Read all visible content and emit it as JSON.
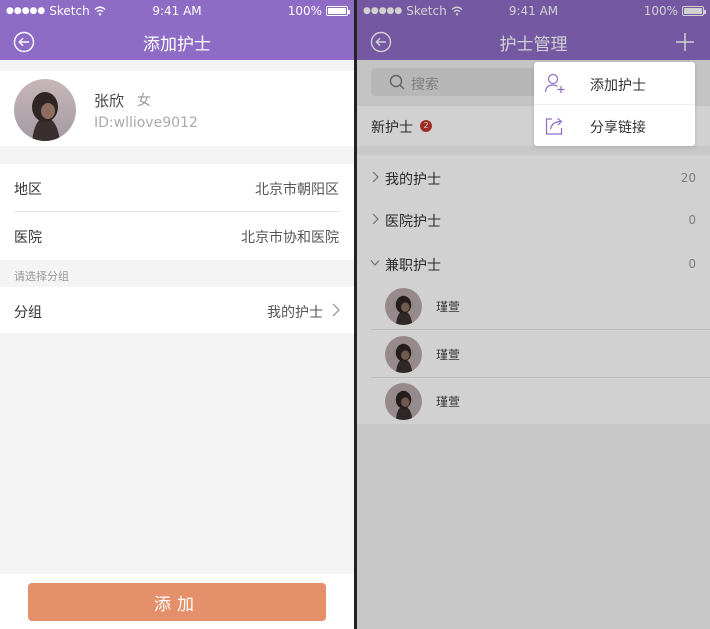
{
  "status_bar": {
    "dots": "●●●●●",
    "carrier": "Sketch",
    "time": "9:41 AM",
    "battery": "100%"
  },
  "left": {
    "title": "添加护士",
    "profile": {
      "name": "张欣",
      "gender": "女",
      "id": "ID:wlliove9012"
    },
    "fields": [
      {
        "label": "地区",
        "value": "北京市朝阳区"
      },
      {
        "label": "医院",
        "value": "北京市协和医院"
      }
    ],
    "group_hint": "请选择分组",
    "group": {
      "label": "分组",
      "value": "我的护士"
    },
    "add_button": "添加"
  },
  "right": {
    "title": "护士管理",
    "search_placeholder": "搜索",
    "new_nurse": {
      "label": "新护士",
      "badge": "2"
    },
    "groups": [
      {
        "label": "我的护士",
        "count": "20",
        "expanded": false
      },
      {
        "label": "医院护士",
        "count": "0",
        "expanded": false
      },
      {
        "label": "兼职护士",
        "count": "0",
        "expanded": true
      }
    ],
    "members": [
      {
        "name": "瑾萱"
      },
      {
        "name": "瑾萱"
      },
      {
        "name": "瑾萱"
      }
    ],
    "popup_menu": [
      {
        "label": "添加护士",
        "icon": "add-user-icon"
      },
      {
        "label": "分享链接",
        "icon": "share-icon"
      }
    ]
  },
  "colors": {
    "header": "#8e6cc6",
    "add_button": "#e4906a",
    "badge": "#c0392b"
  }
}
